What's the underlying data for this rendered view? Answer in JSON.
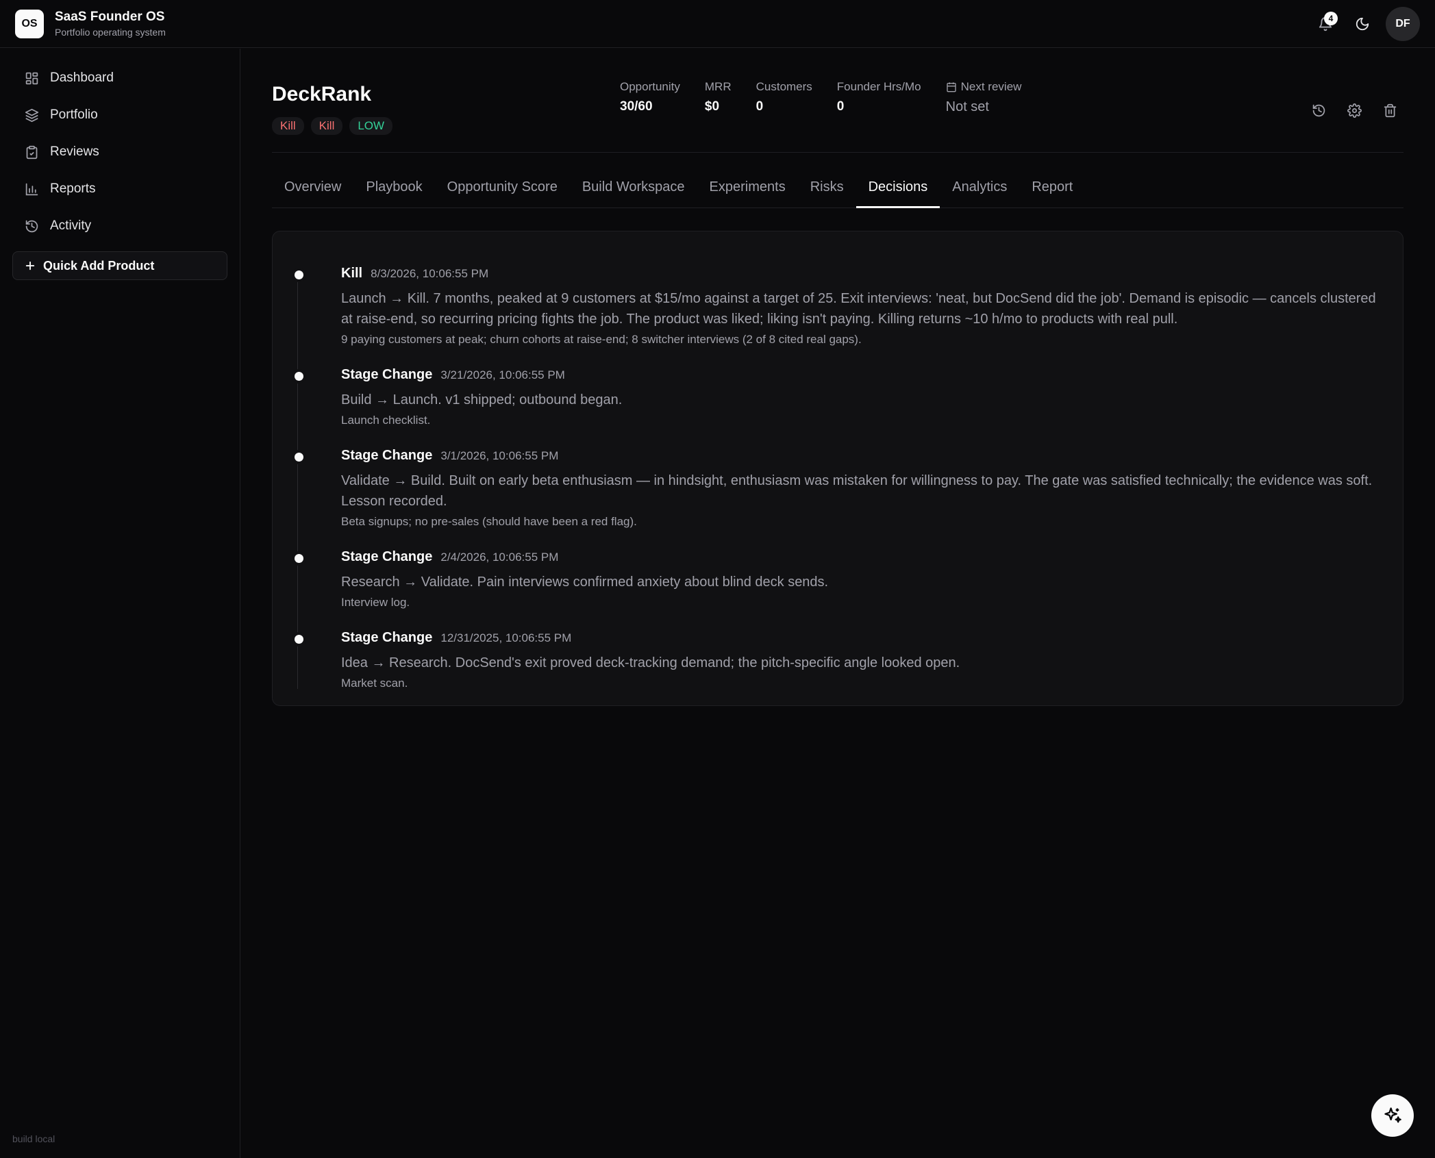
{
  "app": {
    "logo": "OS",
    "title": "SaaS Founder OS",
    "subtitle": "Portfolio operating system",
    "notification_count": "4",
    "avatar_initials": "DF",
    "build_label": "build local"
  },
  "sidebar": {
    "items": [
      {
        "label": "Dashboard",
        "icon": "dashboard-icon"
      },
      {
        "label": "Portfolio",
        "icon": "layers-icon"
      },
      {
        "label": "Reviews",
        "icon": "clipboard-icon"
      },
      {
        "label": "Reports",
        "icon": "bar-chart-icon"
      },
      {
        "label": "Activity",
        "icon": "history-icon"
      }
    ],
    "quick_add_label": "Quick Add Product"
  },
  "product": {
    "name": "DeckRank",
    "tags": [
      {
        "label": "Kill",
        "color": "#f87171"
      },
      {
        "label": "Kill",
        "color": "#f87171"
      },
      {
        "label": "LOW",
        "color": "#34d399"
      }
    ],
    "metrics": [
      {
        "label": "Opportunity",
        "value": "30/60"
      },
      {
        "label": "MRR",
        "value": "$0"
      },
      {
        "label": "Customers",
        "value": "0"
      },
      {
        "label": "Founder Hrs/Mo",
        "value": "0"
      }
    ],
    "next_review": {
      "label": "Next review",
      "value": "Not set"
    }
  },
  "tabs": [
    {
      "label": "Overview",
      "active": false
    },
    {
      "label": "Playbook",
      "active": false
    },
    {
      "label": "Opportunity Score",
      "active": false
    },
    {
      "label": "Build Workspace",
      "active": false
    },
    {
      "label": "Experiments",
      "active": false
    },
    {
      "label": "Risks",
      "active": false
    },
    {
      "label": "Decisions",
      "active": true
    },
    {
      "label": "Analytics",
      "active": false
    },
    {
      "label": "Report",
      "active": false
    }
  ],
  "decisions": [
    {
      "type": "Kill",
      "date": "8/3/2026, 10:06:55 PM",
      "text": "Launch → Kill. 7 months, peaked at 9 customers at $15/mo against a target of 25. Exit interviews: 'neat, but DocSend did the job'. Demand is episodic — cancels clustered at raise-end, so recurring pricing fights the job. The product was liked; liking isn't paying. Killing returns ~10 h/mo to products with real pull.",
      "evidence": "9 paying customers at peak; churn cohorts at raise-end; 8 switcher interviews (2 of 8 cited real gaps)."
    },
    {
      "type": "Stage Change",
      "date": "3/21/2026, 10:06:55 PM",
      "text": "Build → Launch. v1 shipped; outbound began.",
      "evidence": "Launch checklist."
    },
    {
      "type": "Stage Change",
      "date": "3/1/2026, 10:06:55 PM",
      "text": "Validate → Build. Built on early beta enthusiasm — in hindsight, enthusiasm was mistaken for willingness to pay. The gate was satisfied technically; the evidence was soft. Lesson recorded.",
      "evidence": "Beta signups; no pre-sales (should have been a red flag)."
    },
    {
      "type": "Stage Change",
      "date": "2/4/2026, 10:06:55 PM",
      "text": "Research → Validate. Pain interviews confirmed anxiety about blind deck sends.",
      "evidence": "Interview log."
    },
    {
      "type": "Stage Change",
      "date": "12/31/2025, 10:06:55 PM",
      "text": "Idea → Research. DocSend's exit proved deck-tracking demand; the pitch-specific angle looked open.",
      "evidence": "Market scan."
    }
  ]
}
